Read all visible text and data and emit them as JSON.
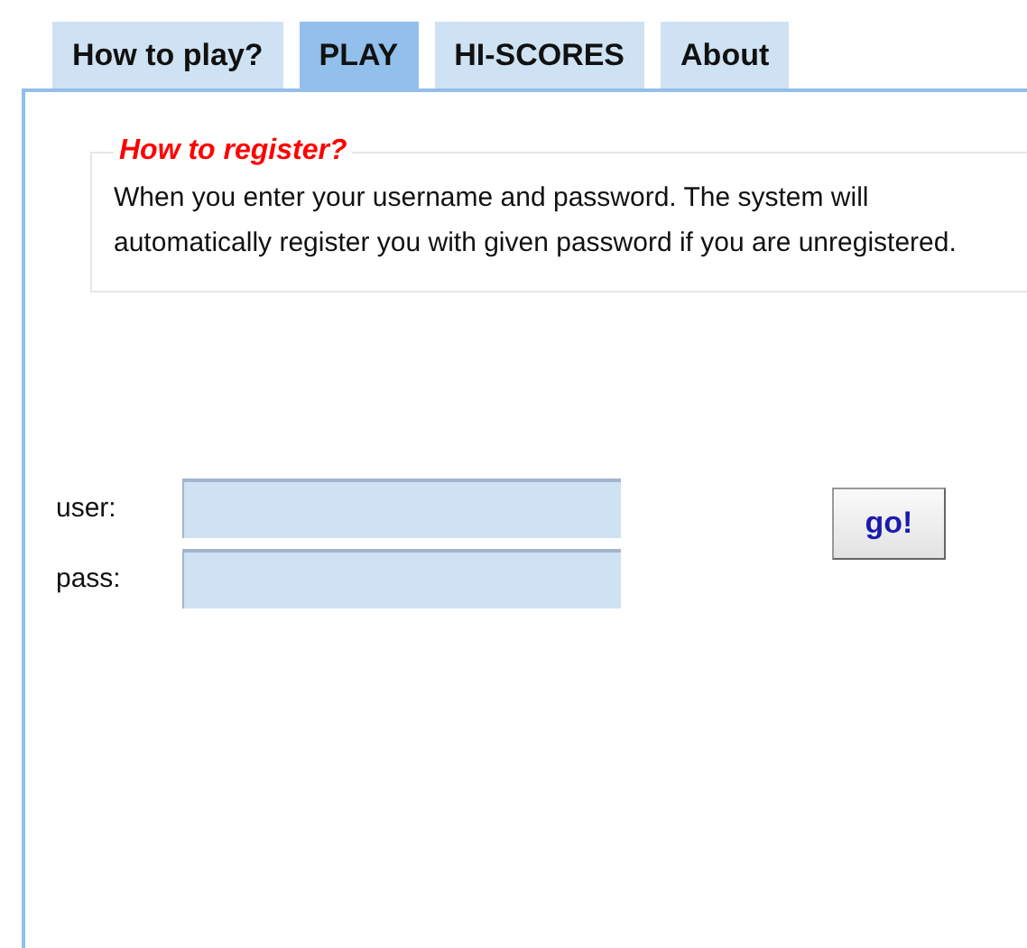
{
  "tabs": [
    {
      "label": "How to play?",
      "selected": false
    },
    {
      "label": "PLAY",
      "selected": true
    },
    {
      "label": "HI-SCORES",
      "selected": false
    },
    {
      "label": "About",
      "selected": false
    }
  ],
  "info": {
    "legend": "How to register?",
    "text": "When you enter your username and password. The system will automatically register you with given password if you are unregistered."
  },
  "form": {
    "fields": [
      {
        "label": "user:"
      },
      {
        "label": "pass:"
      }
    ],
    "button": "go!"
  }
}
